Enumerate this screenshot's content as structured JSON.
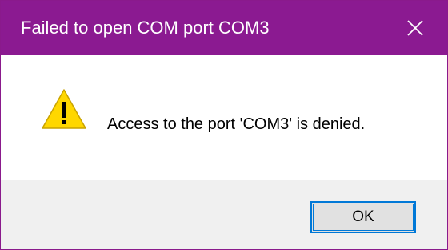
{
  "window": {
    "title": "Failed to open COM port COM3",
    "close_icon": "close-icon",
    "accent_color": "#8b1a91"
  },
  "message": {
    "icon": "warning-icon",
    "text": "Access to the port 'COM3' is denied."
  },
  "buttons": {
    "ok_label": "OK"
  }
}
